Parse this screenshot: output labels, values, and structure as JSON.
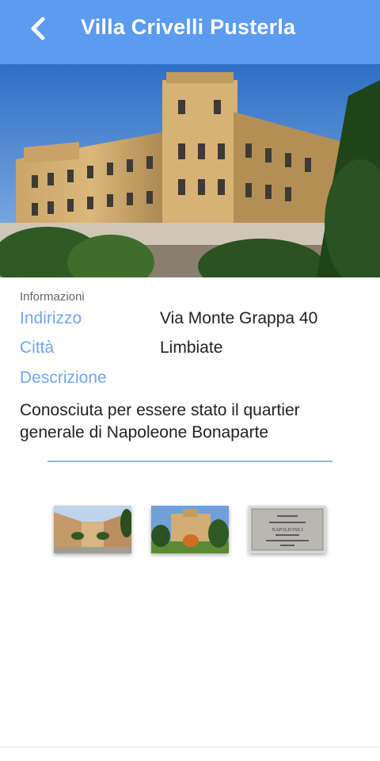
{
  "appbar": {
    "title": "Villa Crivelli Pusterla",
    "back_icon": "chevron-left-icon",
    "color": "#5b9bf0"
  },
  "info": {
    "section_label": "Informazioni",
    "address_label": "Indirizzo",
    "address_value": "Via Monte Grappa 40",
    "city_label": "Città",
    "city_value": "Limbiate",
    "description_label": "Descrizione",
    "description_text": "Conosciuta per essere stato il quartier generale di Napoleone Bonaparte",
    "label_color": "#6fa6ee"
  },
  "gallery": {
    "thumbnails": [
      {
        "name": "courtyard-thumbnail"
      },
      {
        "name": "villa-park-thumbnail"
      },
      {
        "name": "plaque-thumbnail",
        "text": "NAPOLEONE I"
      }
    ]
  }
}
